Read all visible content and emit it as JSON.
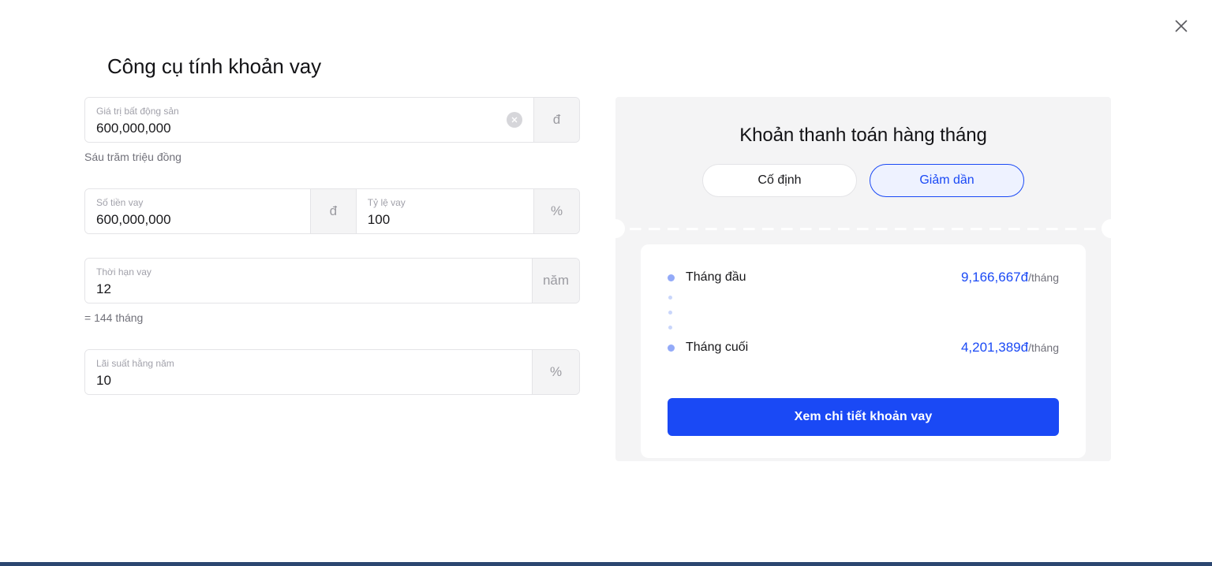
{
  "modal": {
    "title": "Công cụ tính khoản vay",
    "close_icon": "close-icon"
  },
  "form": {
    "property_value": {
      "label": "Giá trị bất động sản",
      "value": "600,000,000",
      "suffix": "đ",
      "clear_icon": "clear-circle-icon",
      "helper": "Sáu trăm triệu đồng"
    },
    "loan_amount": {
      "label": "Số tiền vay",
      "value": "600,000,000",
      "suffix": "đ"
    },
    "loan_ratio": {
      "label": "Tỷ lệ vay",
      "value": "100",
      "suffix": "%"
    },
    "loan_term": {
      "label": "Thời hạn vay",
      "value": "12",
      "suffix": "năm",
      "helper": "= 144 tháng"
    },
    "interest_rate": {
      "label": "Lãi suất hằng năm",
      "value": "10",
      "suffix": "%"
    }
  },
  "summary": {
    "title": "Khoản thanh toán hàng tháng",
    "toggles": [
      {
        "label": "Cố định",
        "selected": false
      },
      {
        "label": "Giảm dần",
        "selected": true
      }
    ],
    "rows": [
      {
        "label": "Tháng đầu",
        "amount": "9,166,667đ",
        "period": "/tháng"
      },
      {
        "label": "Tháng cuối",
        "amount": "4,201,389đ",
        "period": "/tháng"
      }
    ],
    "cta_label": "Xem chi tiết khoản vay"
  },
  "colors": {
    "accent": "#1a49f5",
    "accent_soft": "#eef2ff",
    "panel_bg": "#f4f4f5",
    "dot": "#93aaf8",
    "bottom_strip": "#2b4670"
  }
}
